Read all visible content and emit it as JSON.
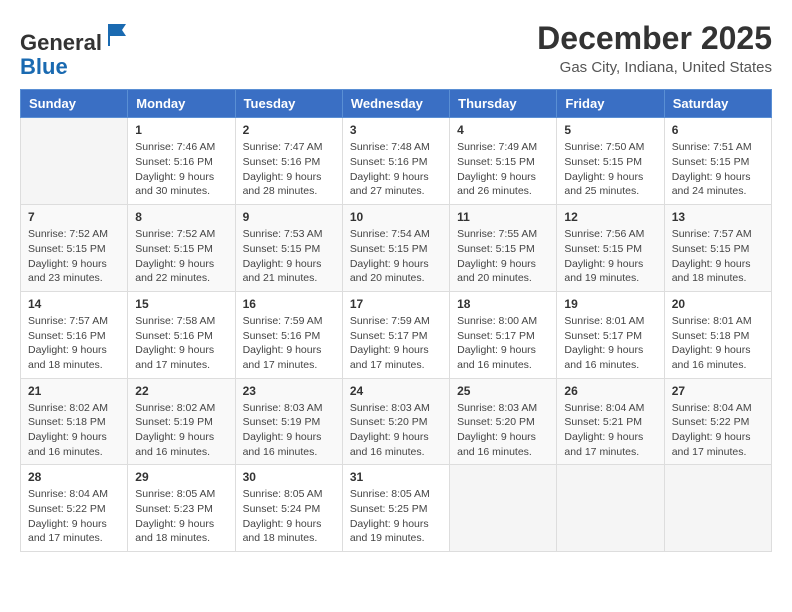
{
  "logo": {
    "general": "General",
    "blue": "Blue"
  },
  "header": {
    "month": "December 2025",
    "location": "Gas City, Indiana, United States"
  },
  "days_of_week": [
    "Sunday",
    "Monday",
    "Tuesday",
    "Wednesday",
    "Thursday",
    "Friday",
    "Saturday"
  ],
  "weeks": [
    [
      {
        "day": "",
        "sunrise": "",
        "sunset": "",
        "daylight": ""
      },
      {
        "day": "1",
        "sunrise": "Sunrise: 7:46 AM",
        "sunset": "Sunset: 5:16 PM",
        "daylight": "Daylight: 9 hours and 30 minutes."
      },
      {
        "day": "2",
        "sunrise": "Sunrise: 7:47 AM",
        "sunset": "Sunset: 5:16 PM",
        "daylight": "Daylight: 9 hours and 28 minutes."
      },
      {
        "day": "3",
        "sunrise": "Sunrise: 7:48 AM",
        "sunset": "Sunset: 5:16 PM",
        "daylight": "Daylight: 9 hours and 27 minutes."
      },
      {
        "day": "4",
        "sunrise": "Sunrise: 7:49 AM",
        "sunset": "Sunset: 5:15 PM",
        "daylight": "Daylight: 9 hours and 26 minutes."
      },
      {
        "day": "5",
        "sunrise": "Sunrise: 7:50 AM",
        "sunset": "Sunset: 5:15 PM",
        "daylight": "Daylight: 9 hours and 25 minutes."
      },
      {
        "day": "6",
        "sunrise": "Sunrise: 7:51 AM",
        "sunset": "Sunset: 5:15 PM",
        "daylight": "Daylight: 9 hours and 24 minutes."
      }
    ],
    [
      {
        "day": "7",
        "sunrise": "Sunrise: 7:52 AM",
        "sunset": "Sunset: 5:15 PM",
        "daylight": "Daylight: 9 hours and 23 minutes."
      },
      {
        "day": "8",
        "sunrise": "Sunrise: 7:52 AM",
        "sunset": "Sunset: 5:15 PM",
        "daylight": "Daylight: 9 hours and 22 minutes."
      },
      {
        "day": "9",
        "sunrise": "Sunrise: 7:53 AM",
        "sunset": "Sunset: 5:15 PM",
        "daylight": "Daylight: 9 hours and 21 minutes."
      },
      {
        "day": "10",
        "sunrise": "Sunrise: 7:54 AM",
        "sunset": "Sunset: 5:15 PM",
        "daylight": "Daylight: 9 hours and 20 minutes."
      },
      {
        "day": "11",
        "sunrise": "Sunrise: 7:55 AM",
        "sunset": "Sunset: 5:15 PM",
        "daylight": "Daylight: 9 hours and 20 minutes."
      },
      {
        "day": "12",
        "sunrise": "Sunrise: 7:56 AM",
        "sunset": "Sunset: 5:15 PM",
        "daylight": "Daylight: 9 hours and 19 minutes."
      },
      {
        "day": "13",
        "sunrise": "Sunrise: 7:57 AM",
        "sunset": "Sunset: 5:15 PM",
        "daylight": "Daylight: 9 hours and 18 minutes."
      }
    ],
    [
      {
        "day": "14",
        "sunrise": "Sunrise: 7:57 AM",
        "sunset": "Sunset: 5:16 PM",
        "daylight": "Daylight: 9 hours and 18 minutes."
      },
      {
        "day": "15",
        "sunrise": "Sunrise: 7:58 AM",
        "sunset": "Sunset: 5:16 PM",
        "daylight": "Daylight: 9 hours and 17 minutes."
      },
      {
        "day": "16",
        "sunrise": "Sunrise: 7:59 AM",
        "sunset": "Sunset: 5:16 PM",
        "daylight": "Daylight: 9 hours and 17 minutes."
      },
      {
        "day": "17",
        "sunrise": "Sunrise: 7:59 AM",
        "sunset": "Sunset: 5:17 PM",
        "daylight": "Daylight: 9 hours and 17 minutes."
      },
      {
        "day": "18",
        "sunrise": "Sunrise: 8:00 AM",
        "sunset": "Sunset: 5:17 PM",
        "daylight": "Daylight: 9 hours and 16 minutes."
      },
      {
        "day": "19",
        "sunrise": "Sunrise: 8:01 AM",
        "sunset": "Sunset: 5:17 PM",
        "daylight": "Daylight: 9 hours and 16 minutes."
      },
      {
        "day": "20",
        "sunrise": "Sunrise: 8:01 AM",
        "sunset": "Sunset: 5:18 PM",
        "daylight": "Daylight: 9 hours and 16 minutes."
      }
    ],
    [
      {
        "day": "21",
        "sunrise": "Sunrise: 8:02 AM",
        "sunset": "Sunset: 5:18 PM",
        "daylight": "Daylight: 9 hours and 16 minutes."
      },
      {
        "day": "22",
        "sunrise": "Sunrise: 8:02 AM",
        "sunset": "Sunset: 5:19 PM",
        "daylight": "Daylight: 9 hours and 16 minutes."
      },
      {
        "day": "23",
        "sunrise": "Sunrise: 8:03 AM",
        "sunset": "Sunset: 5:19 PM",
        "daylight": "Daylight: 9 hours and 16 minutes."
      },
      {
        "day": "24",
        "sunrise": "Sunrise: 8:03 AM",
        "sunset": "Sunset: 5:20 PM",
        "daylight": "Daylight: 9 hours and 16 minutes."
      },
      {
        "day": "25",
        "sunrise": "Sunrise: 8:03 AM",
        "sunset": "Sunset: 5:20 PM",
        "daylight": "Daylight: 9 hours and 16 minutes."
      },
      {
        "day": "26",
        "sunrise": "Sunrise: 8:04 AM",
        "sunset": "Sunset: 5:21 PM",
        "daylight": "Daylight: 9 hours and 17 minutes."
      },
      {
        "day": "27",
        "sunrise": "Sunrise: 8:04 AM",
        "sunset": "Sunset: 5:22 PM",
        "daylight": "Daylight: 9 hours and 17 minutes."
      }
    ],
    [
      {
        "day": "28",
        "sunrise": "Sunrise: 8:04 AM",
        "sunset": "Sunset: 5:22 PM",
        "daylight": "Daylight: 9 hours and 17 minutes."
      },
      {
        "day": "29",
        "sunrise": "Sunrise: 8:05 AM",
        "sunset": "Sunset: 5:23 PM",
        "daylight": "Daylight: 9 hours and 18 minutes."
      },
      {
        "day": "30",
        "sunrise": "Sunrise: 8:05 AM",
        "sunset": "Sunset: 5:24 PM",
        "daylight": "Daylight: 9 hours and 18 minutes."
      },
      {
        "day": "31",
        "sunrise": "Sunrise: 8:05 AM",
        "sunset": "Sunset: 5:25 PM",
        "daylight": "Daylight: 9 hours and 19 minutes."
      },
      {
        "day": "",
        "sunrise": "",
        "sunset": "",
        "daylight": ""
      },
      {
        "day": "",
        "sunrise": "",
        "sunset": "",
        "daylight": ""
      },
      {
        "day": "",
        "sunrise": "",
        "sunset": "",
        "daylight": ""
      }
    ]
  ]
}
